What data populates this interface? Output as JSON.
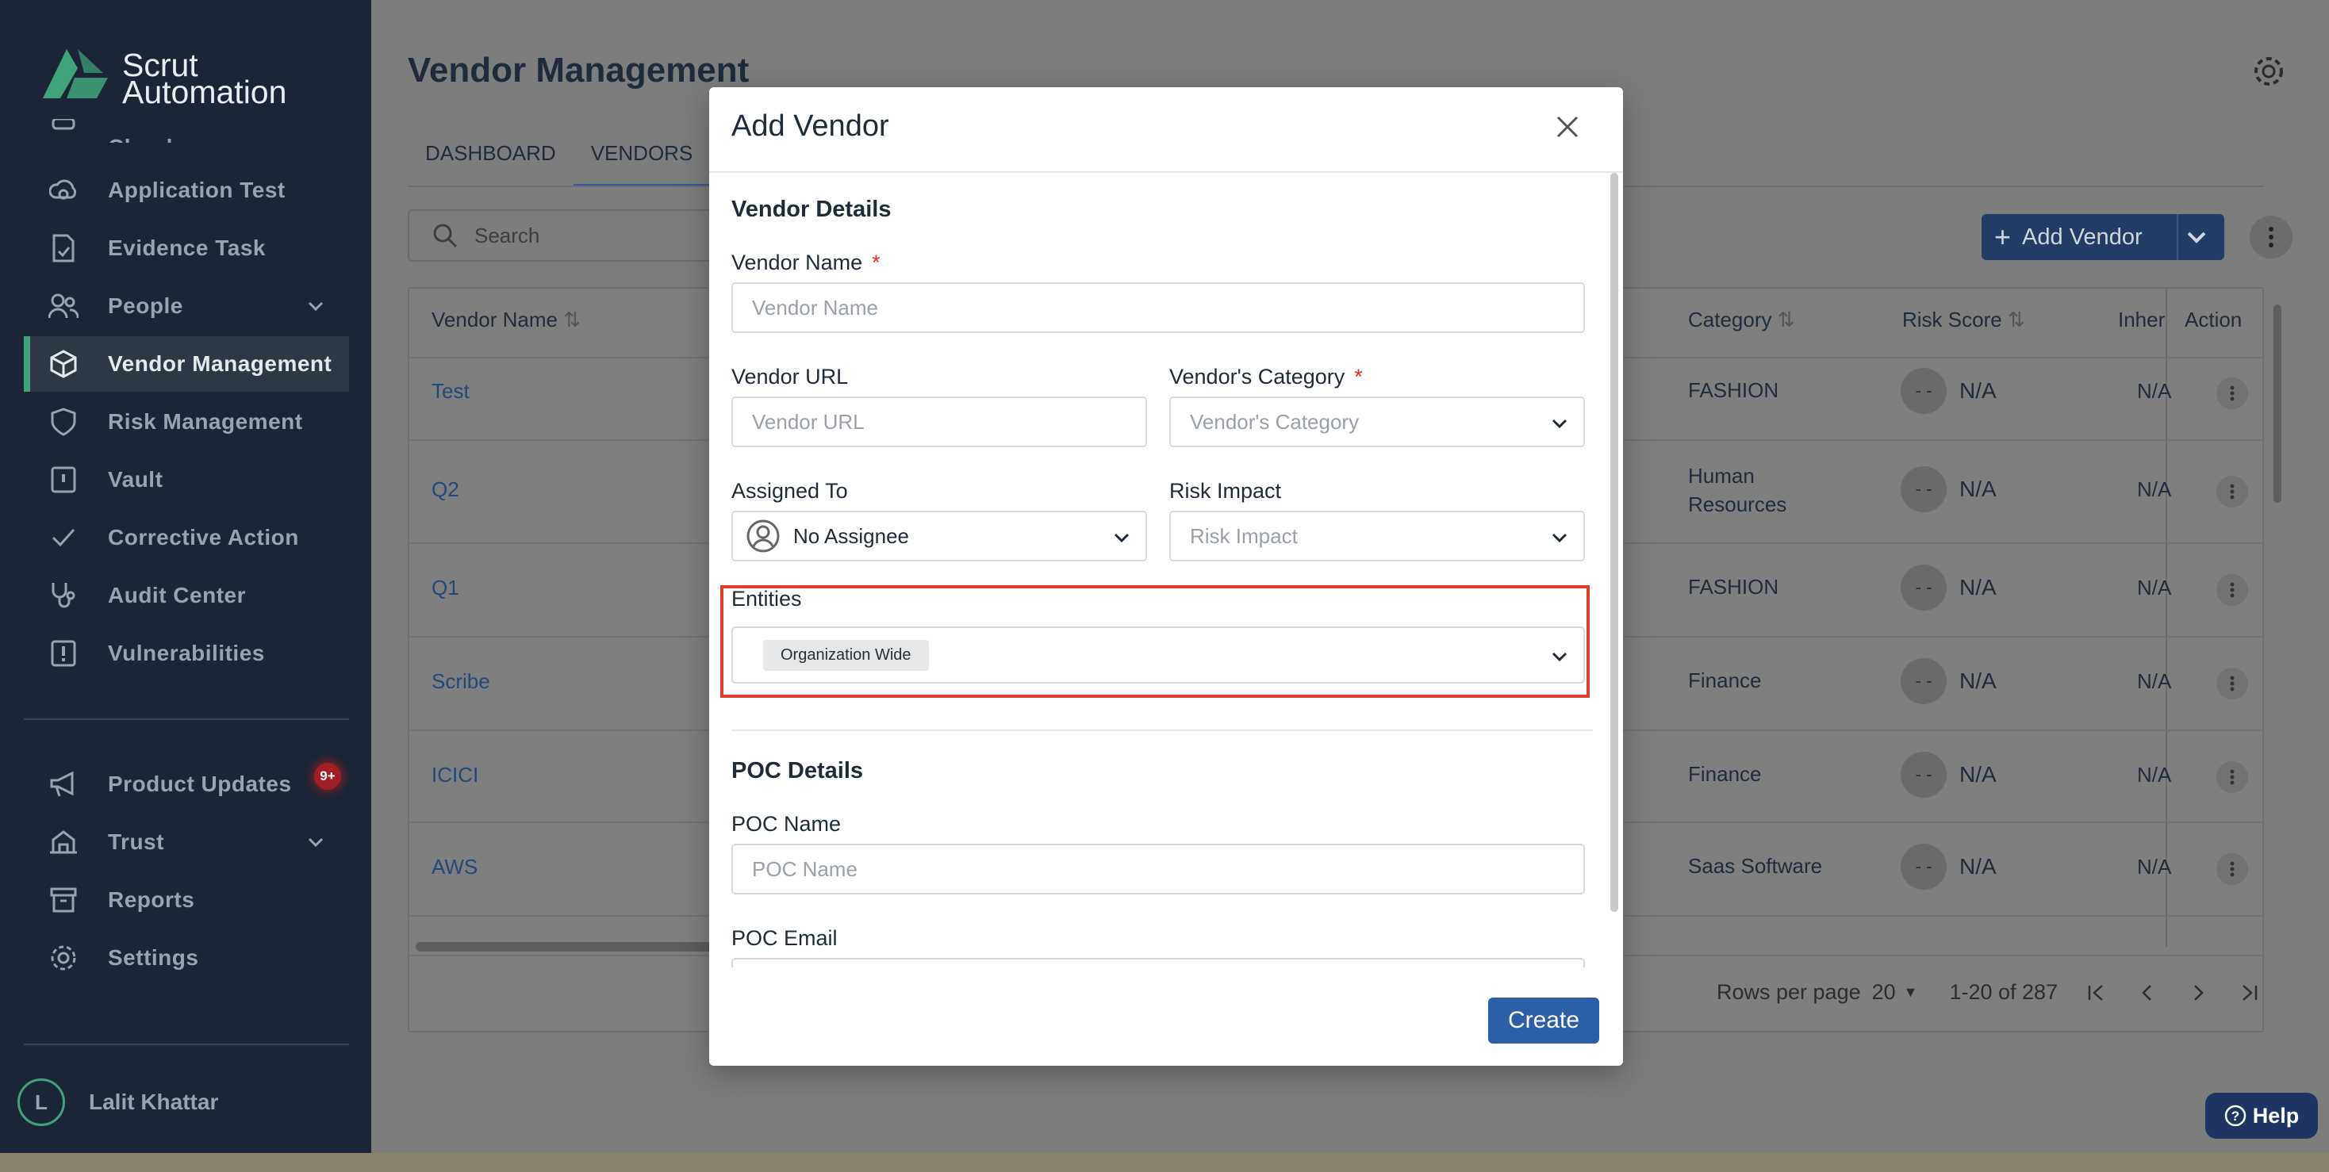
{
  "app": {
    "brand_line1": "Scrut",
    "brand_line2": "Automation"
  },
  "sidebar": {
    "partial_item": "Cloud",
    "items": [
      {
        "label": "Application Test",
        "icon": "cloud-shield-icon"
      },
      {
        "label": "Evidence Task",
        "icon": "document-check-icon"
      },
      {
        "label": "People",
        "icon": "people-icon"
      },
      {
        "label": "Vendor Management",
        "icon": "box-icon"
      },
      {
        "label": "Risk Management",
        "icon": "shield-icon"
      },
      {
        "label": "Vault",
        "icon": "vault-icon"
      },
      {
        "label": "Corrective Action",
        "icon": "check-icon"
      },
      {
        "label": "Audit Center",
        "icon": "stethoscope-icon"
      },
      {
        "label": "Vulnerabilities",
        "icon": "alert-icon"
      },
      {
        "label": "Product Updates",
        "icon": "megaphone-icon"
      },
      {
        "label": "Trust",
        "icon": "trust-icon"
      },
      {
        "label": "Reports",
        "icon": "archive-icon"
      },
      {
        "label": "Settings",
        "icon": "gear-icon"
      }
    ],
    "badge": "9+",
    "user_initial": "L",
    "user_name": "Lalit Khattar"
  },
  "page": {
    "title": "Vendor Management",
    "tabs": [
      "DASHBOARD",
      "VENDORS"
    ],
    "search_placeholder": "Search",
    "add_vendor_label": "Add Vendor"
  },
  "table": {
    "headers": {
      "vendor_name": "Vendor Name",
      "category": "Category",
      "risk_score": "Risk Score",
      "inherent": "Inher",
      "action": "Action"
    },
    "rows": [
      {
        "name": "Test",
        "category": "FASHION",
        "risk": "N/A",
        "inh": "N/A"
      },
      {
        "name": "Q2",
        "category": "Human Resources",
        "risk": "N/A",
        "inh": "N/A"
      },
      {
        "name": "Q1",
        "category": "FASHION",
        "risk": "N/A",
        "inh": "N/A"
      },
      {
        "name": "Scribe",
        "category": "Finance",
        "risk": "N/A",
        "inh": "N/A"
      },
      {
        "name": "ICICI",
        "category": "Finance",
        "risk": "N/A",
        "inh": "N/A"
      },
      {
        "name": "AWS",
        "category": "Saas Software",
        "risk": "N/A",
        "inh": "N/A"
      }
    ],
    "score_placeholder": "- -",
    "rows_per_page_label": "Rows per page",
    "rows_per_page_value": "20",
    "range": "1-20 of 287"
  },
  "help_label": "Help",
  "modal": {
    "title": "Add Vendor",
    "vendor_details": "Vendor Details",
    "vendor_name_label": "Vendor Name",
    "vendor_name_placeholder": "Vendor Name",
    "vendor_url_label": "Vendor URL",
    "vendor_url_placeholder": "Vendor URL",
    "vendor_category_label": "Vendor's Category",
    "vendor_category_placeholder": "Vendor's Category",
    "assigned_to_label": "Assigned To",
    "assigned_to_value": "No Assignee",
    "risk_impact_label": "Risk Impact",
    "risk_impact_placeholder": "Risk Impact",
    "entities_label": "Entities",
    "entities_chip": "Organization Wide",
    "poc_details": "POC Details",
    "poc_name_label": "POC Name",
    "poc_name_placeholder": "POC Name",
    "poc_email_label": "POC Email",
    "required_mark": "*",
    "create_label": "Create"
  }
}
